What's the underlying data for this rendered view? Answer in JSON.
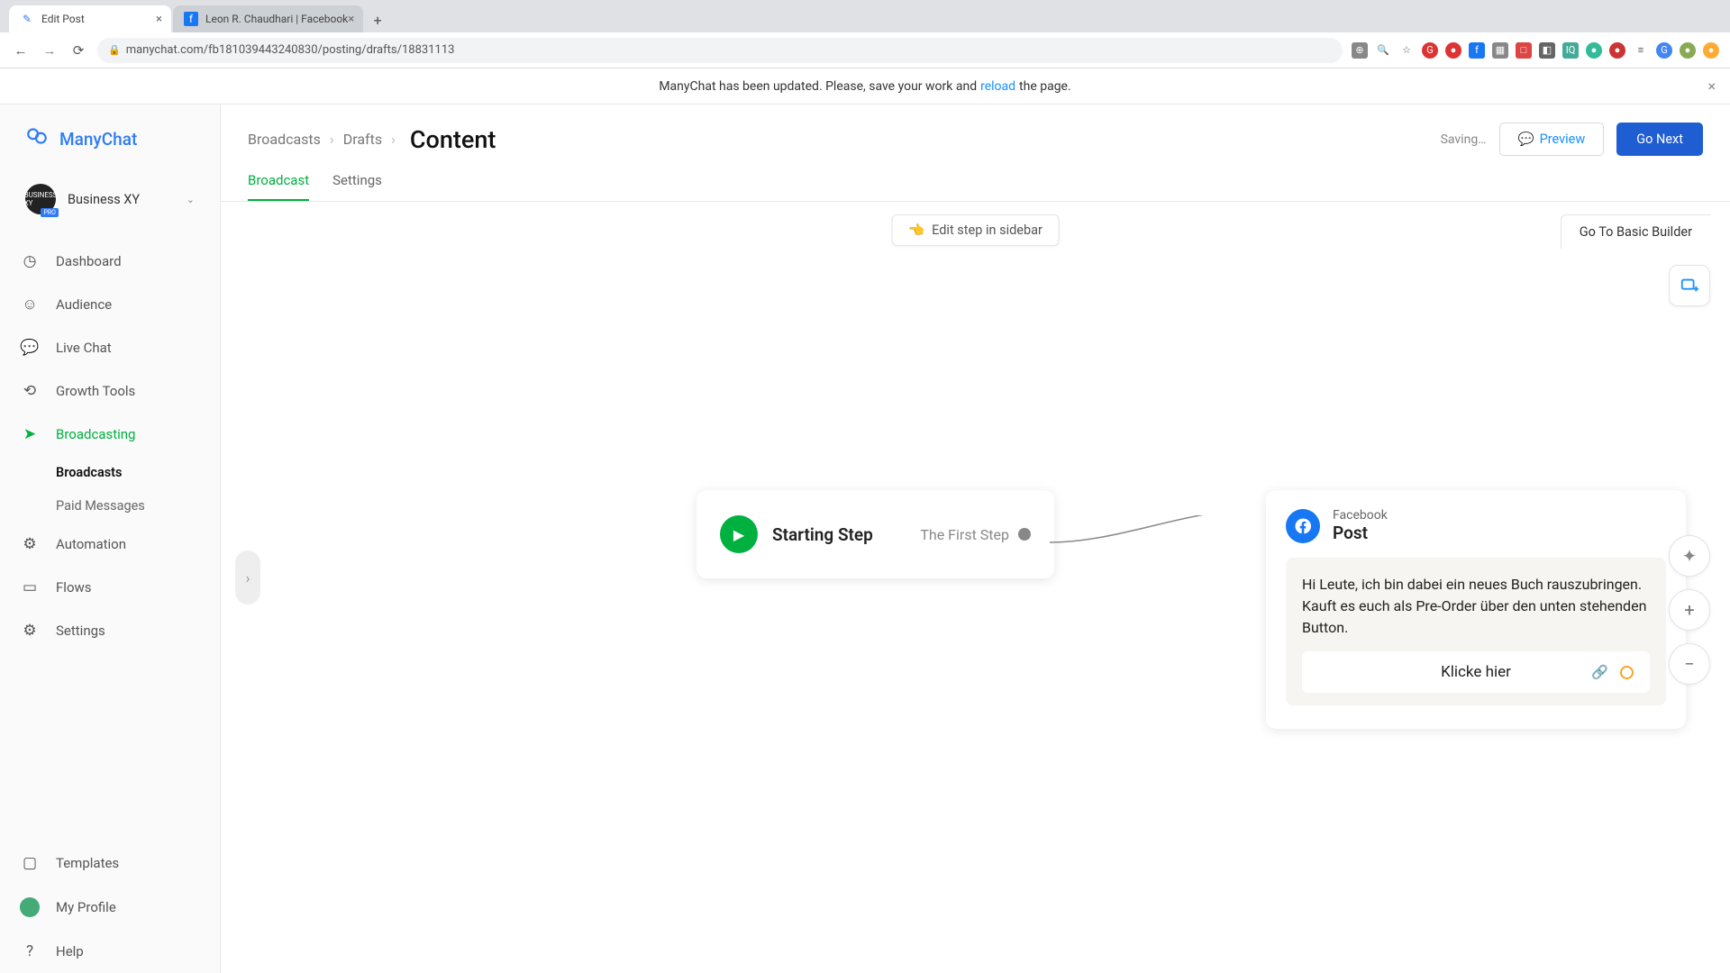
{
  "browser": {
    "tabs": [
      {
        "title": "Edit Post",
        "active": true
      },
      {
        "title": "Leon R. Chaudhari | Facebook",
        "active": false
      }
    ],
    "url": "manychat.com/fb181039443240830/posting/drafts/18831113"
  },
  "banner": {
    "prefix": "ManyChat has been updated. Please, save your work and ",
    "link": "reload",
    "suffix": " the page."
  },
  "logo": "ManyChat",
  "account": {
    "name": "Business XY",
    "badge": "PRO"
  },
  "sidebar": {
    "items": [
      {
        "label": "Dashboard"
      },
      {
        "label": "Audience"
      },
      {
        "label": "Live Chat"
      },
      {
        "label": "Growth Tools"
      },
      {
        "label": "Broadcasting"
      },
      {
        "label": "Automation"
      },
      {
        "label": "Flows"
      },
      {
        "label": "Settings"
      }
    ],
    "sub": {
      "broadcasts": "Broadcasts",
      "paid": "Paid Messages"
    },
    "bottom": {
      "templates": "Templates",
      "profile": "My Profile",
      "help": "Help"
    }
  },
  "header": {
    "crumb1": "Broadcasts",
    "crumb2": "Drafts",
    "title": "Content",
    "saving": "Saving…",
    "preview": "Preview",
    "next": "Go Next"
  },
  "tabs_row": {
    "broadcast": "Broadcast",
    "settings": "Settings"
  },
  "canvas": {
    "edit_sidebar": "Edit step in sidebar",
    "basic_builder": "Go To Basic Builder",
    "start_node": {
      "title": "Starting Step",
      "subtitle": "The First Step"
    },
    "post_node": {
      "platform": "Facebook",
      "type": "Post",
      "text": "Hi Leute, ich bin dabei ein neues Buch rauszubringen. Kauft es euch als Pre-Order über den unten stehenden Button.",
      "button_label": "Klicke hier"
    }
  }
}
